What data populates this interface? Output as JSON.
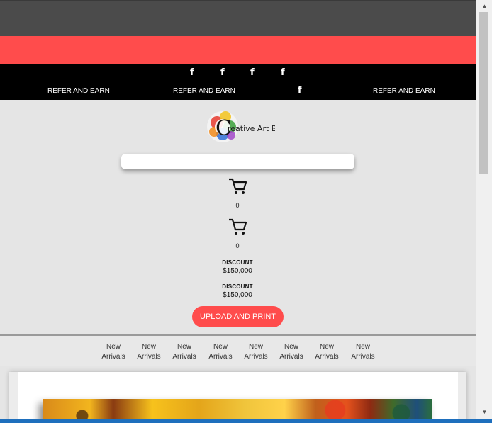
{
  "social": {
    "facebook_glyph": "f"
  },
  "refer_links": [
    "REFER AND EARN",
    "REFER AND EARN",
    "REFER AND EARN"
  ],
  "logo": {
    "text_c": "C",
    "text_rest": "reative Art Box"
  },
  "search": {
    "placeholder": ""
  },
  "carts": [
    {
      "count": "0"
    },
    {
      "count": "0"
    }
  ],
  "discounts": [
    {
      "label": "DISCOUNT",
      "value": "$150,000"
    },
    {
      "label": "DISCOUNT",
      "value": "$150,000"
    }
  ],
  "upload_button": "UPLOAD AND PRINT",
  "nav": {
    "items": [
      {
        "line1": "New",
        "line2": "Arrivals"
      },
      {
        "line1": "New",
        "line2": "Arrivals"
      },
      {
        "line1": "New",
        "line2": "Arrivals"
      },
      {
        "line1": "New",
        "line2": "Arrivals"
      },
      {
        "line1": "New",
        "line2": "Arrivals"
      },
      {
        "line1": "New",
        "line2": "Arrivals"
      },
      {
        "line1": "New",
        "line2": "Arrivals"
      },
      {
        "line1": "New",
        "line2": "Arrivals"
      }
    ]
  },
  "scrollbar": {
    "up_glyph": "▲",
    "down_glyph": "▼"
  },
  "colors": {
    "accent": "#ff4c4c",
    "header": "#4b4b4b",
    "social_bar": "#000000",
    "page_bg": "#e5e5e5"
  }
}
